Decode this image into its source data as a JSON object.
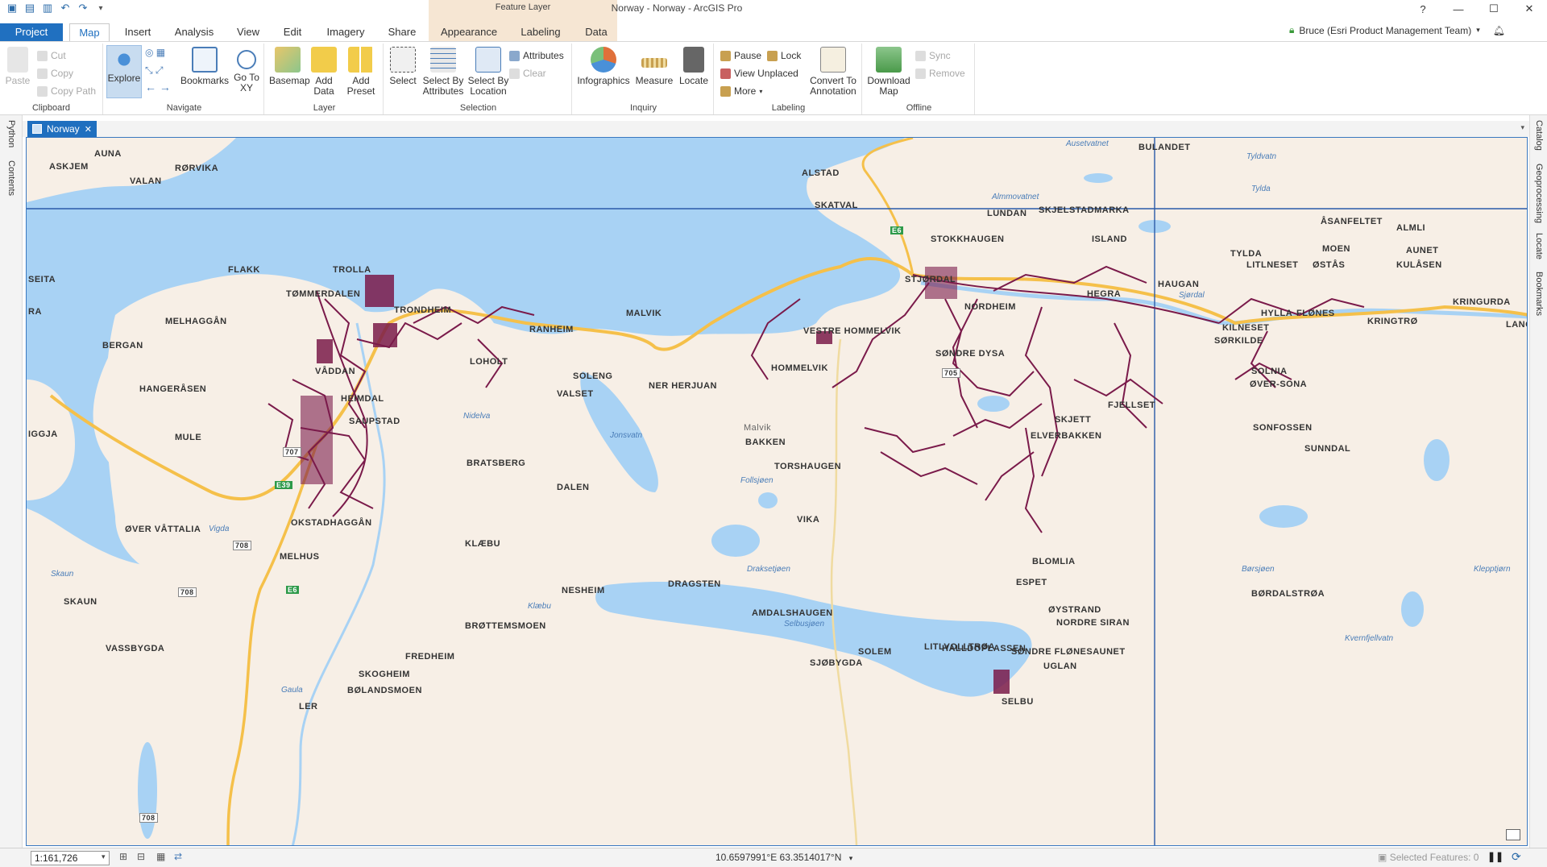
{
  "window": {
    "title": "Norway - Norway - ArcGIS Pro",
    "context_group": "Feature Layer"
  },
  "tabs": [
    {
      "label": "Project"
    },
    {
      "label": "Map"
    },
    {
      "label": "Insert"
    },
    {
      "label": "Analysis"
    },
    {
      "label": "View"
    },
    {
      "label": "Edit"
    },
    {
      "label": "Imagery"
    },
    {
      "label": "Share"
    },
    {
      "label": "Appearance"
    },
    {
      "label": "Labeling"
    },
    {
      "label": "Data"
    }
  ],
  "user": "Bruce (Esri Product Management Team)",
  "ribbon": {
    "clipboard": {
      "label": "Clipboard",
      "paste": "Paste",
      "cut": "Cut",
      "copy": "Copy",
      "copy_path": "Copy Path"
    },
    "navigate": {
      "label": "Navigate",
      "explore": "Explore",
      "bookmarks": "Bookmarks",
      "goto": "Go To XY"
    },
    "layer": {
      "label": "Layer",
      "basemap": "Basemap",
      "add_data": "Add Data",
      "add_preset": "Add Preset"
    },
    "selection": {
      "label": "Selection",
      "select": "Select",
      "by_attr": "Select By Attributes",
      "by_loc": "Select By Location",
      "attributes": "Attributes",
      "clear": "Clear"
    },
    "inquiry": {
      "label": "Inquiry",
      "infographics": "Infographics",
      "measure": "Measure",
      "locate": "Locate"
    },
    "labeling": {
      "label": "Labeling",
      "pause": "Pause",
      "lock": "Lock",
      "view_unplaced": "View Unplaced",
      "more": "More",
      "convert": "Convert To Annotation"
    },
    "offline": {
      "label": "Offline",
      "download": "Download Map",
      "sync": "Sync",
      "remove": "Remove"
    }
  },
  "docks": {
    "left": [
      "Python",
      "Contents"
    ],
    "right": [
      "Catalog",
      "Geoprocessing",
      "Locate",
      "Bookmarks"
    ]
  },
  "map_view": {
    "tab_label": "Norway"
  },
  "map_labels": [
    "AUNA",
    "ASKJEM",
    "RØRVIKA",
    "VALAN",
    "ALSTAD",
    "SKATVAL",
    "BULANDET",
    "LUNDAN",
    "SKJELSTADMARKA",
    "STOKKHAUGEN",
    "ISLAND",
    "ÅSANFELTET",
    "ALMLI",
    "MOEN",
    "AUNET",
    "TYLDA",
    "LITLNESET",
    "ØSTÅS",
    "KULÅSEN",
    "KRINGURDA",
    "FLAKK",
    "TROLLA",
    "TØMMERDALEN",
    "MELHAGGÅN",
    "TRONDHEIM",
    "MALVIK",
    "RANHEIM",
    "VESTRE HOMMELVIK",
    "HOMMELVIK",
    "BERGAN",
    "VÅDDAN",
    "LOHOLT",
    "SOLENG",
    "NER HERJUAN",
    "VALSET",
    "SØNDRE DYSA",
    "HANGERÅSEN",
    "HEIMDAL",
    "SAUPSTAD",
    "SKJETT",
    "ELVERBAKKEN",
    "FJELLSET",
    "SOLNIA",
    "ØVER-SONA",
    "SONFOSSEN",
    "SUNNDAL",
    "MULE",
    "BRATSBERG",
    "BAKKEN",
    "TORSHAUGEN",
    "DALEN",
    "ØVER VÅTTALIA",
    "OKSTADHAGGÅN",
    "VIKA",
    "KLÆBU",
    "MELHUS",
    "BLOMLIA",
    "SKAUN",
    "NESHEIM",
    "DRAGSTEN",
    "ESPET",
    "BØRDALSTRØA",
    "AMDALSHAUGEN",
    "ØYSTRAND",
    "NORDRE SIRAN",
    "BRØTTEMSMOEN",
    "VASSBYGDA",
    "HALLDOPLASSEN",
    "SOLEM",
    "LITLVOLLTRØA",
    "SØNDRE FLØNESAUNET",
    "UGLAN",
    "FREDHEIM",
    "SJØBYGDA",
    "SKOGHEIM",
    "BØLANDSMOEN",
    "LER",
    "SELBU",
    "FLØNES",
    "KRINGTRØ",
    "HYLLA",
    "SØRKILDE",
    "KILNESET",
    "NORDHEIM",
    "STJØRDAL",
    "HEGRA",
    "HAUGAN",
    "IGGJA",
    "SEITA",
    "LANG",
    "RA",
    "Malvik"
  ],
  "water_labels": [
    "Ausetvatnet",
    "Almmovatnet",
    "Tyldvatn",
    "Jonsvatn",
    "Follsjøen",
    "Draksetjøen",
    "Selbusjøen",
    "Børsjøen",
    "Klepptjørn",
    "Kvernfjellvatn",
    "Klæbu",
    "Skaun",
    "Vigda",
    "Gaula",
    "Tylda",
    "Nidelva",
    "Sjørdal"
  ],
  "road_shields": [
    "707",
    "E39",
    "708",
    "708",
    "708",
    "E6",
    "E6",
    "705"
  ],
  "status": {
    "scale": "1:161,726",
    "coords": "10.6597991°E 63.3514017°N",
    "selected": "Selected Features: 0"
  }
}
